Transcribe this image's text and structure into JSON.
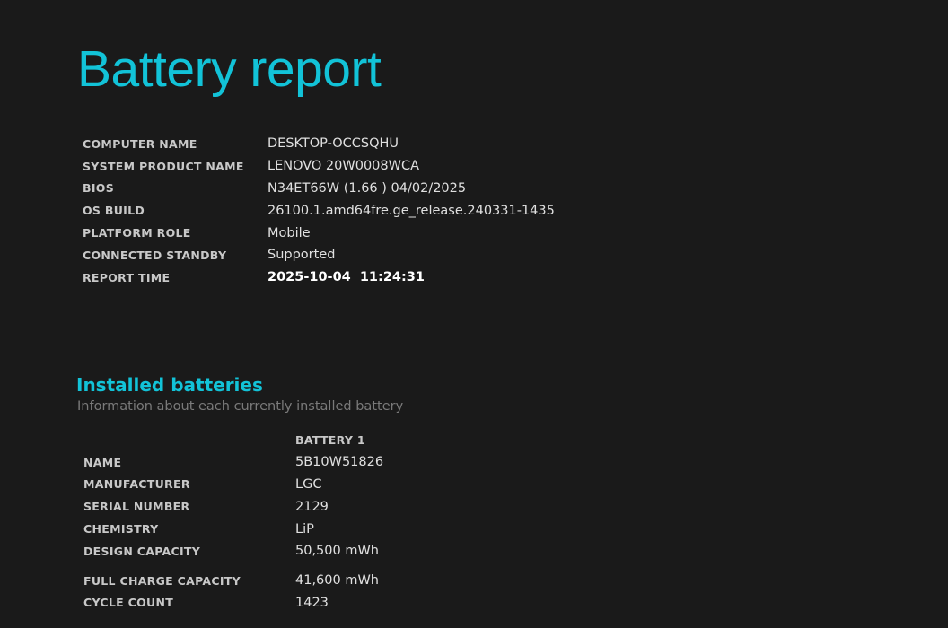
{
  "page": {
    "title": "Battery report"
  },
  "system_info": [
    {
      "label": "COMPUTER NAME",
      "value": "DESKTOP-OCCSQHU"
    },
    {
      "label": "SYSTEM PRODUCT NAME",
      "value": "LENOVO 20W0008WCA"
    },
    {
      "label": "BIOS",
      "value": "N34ET66W (1.66 ) 04/02/2025"
    },
    {
      "label": "OS BUILD",
      "value": "26100.1.amd64fre.ge_release.240331-1435"
    },
    {
      "label": "PLATFORM ROLE",
      "value": "Mobile"
    },
    {
      "label": "CONNECTED STANDBY",
      "value": "Supported"
    },
    {
      "label": "REPORT TIME",
      "value": "2025-10-04  11:24:31"
    }
  ],
  "installed_batteries": {
    "title": "Installed batteries",
    "subtitle": "Information about each currently installed battery",
    "column_header": "BATTERY 1",
    "rows": [
      {
        "label": "NAME",
        "value": "5B10W51826"
      },
      {
        "label": "MANUFACTURER",
        "value": "LGC"
      },
      {
        "label": "SERIAL NUMBER",
        "value": "2129"
      },
      {
        "label": "CHEMISTRY",
        "value": "LiP"
      },
      {
        "label": "DESIGN CAPACITY",
        "value": "50,500 mWh"
      },
      {
        "label": "FULL CHARGE CAPACITY",
        "value": "41,600 mWh"
      },
      {
        "label": "CYCLE COUNT",
        "value": "1423"
      }
    ]
  },
  "colors": {
    "accent": "#12c3d8",
    "background": "#1a1a1a"
  }
}
